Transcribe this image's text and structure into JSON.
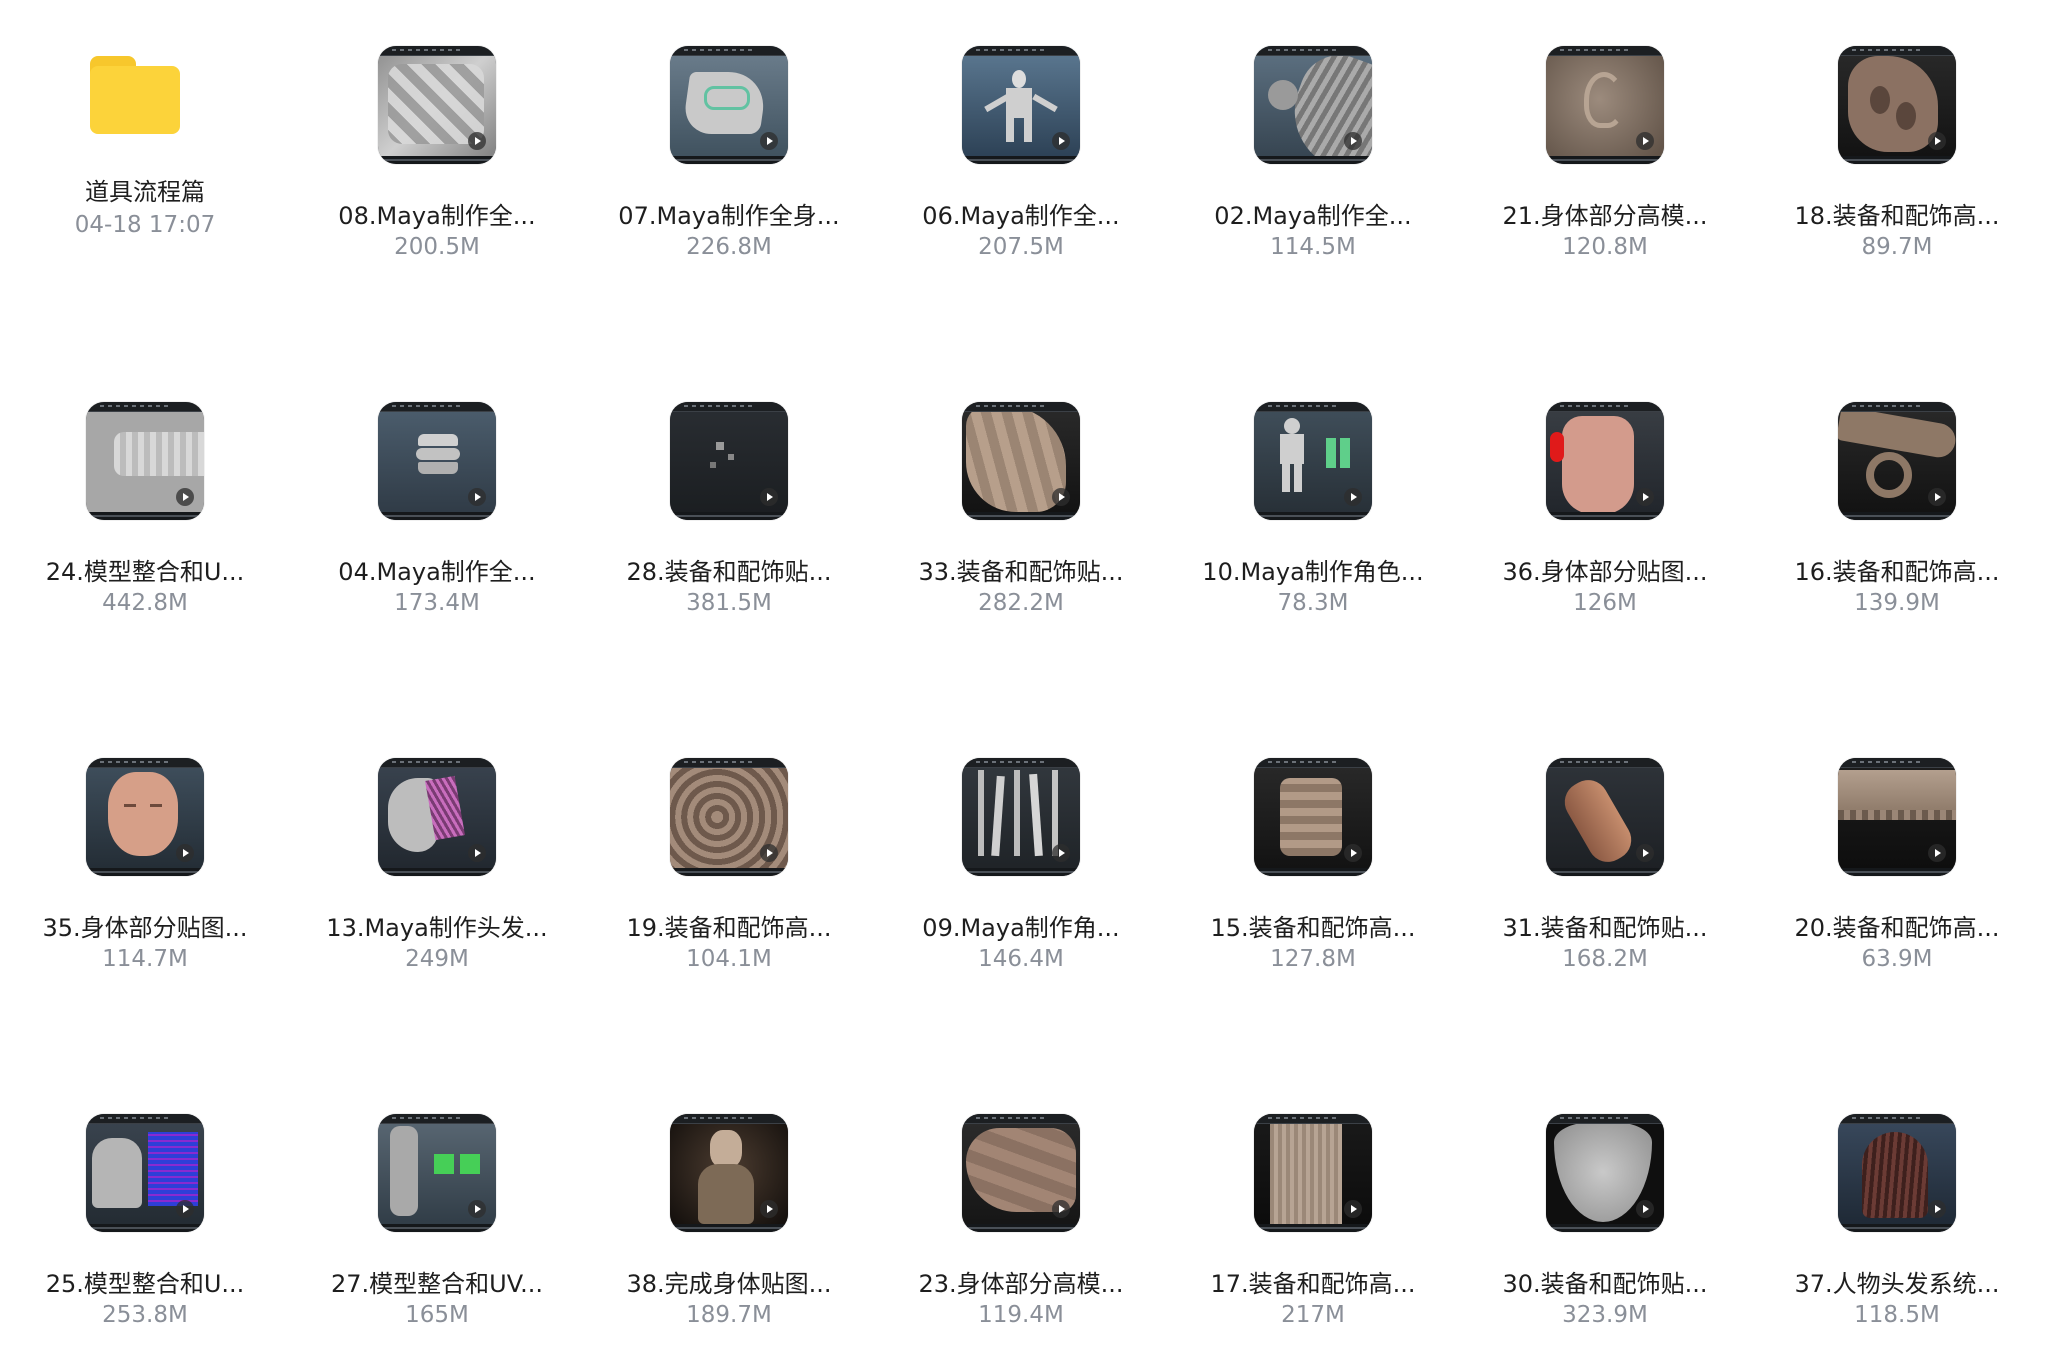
{
  "folder": {
    "name": "道具流程篇",
    "date": "04-18 17:07"
  },
  "files": [
    {
      "name": "08.Maya制作全...",
      "size": "200.5M",
      "thumb": "stone-relief"
    },
    {
      "name": "07.Maya制作全身...",
      "size": "226.8M",
      "thumb": "armor-green"
    },
    {
      "name": "06.Maya制作全...",
      "size": "207.5M",
      "thumb": "figure-blue"
    },
    {
      "name": "02.Maya制作全...",
      "size": "114.5M",
      "thumb": "shoulder-gray"
    },
    {
      "name": "21.身体部分高模...",
      "size": "120.8M",
      "thumb": "ear-sculpt"
    },
    {
      "name": "18.装备和配饰高...",
      "size": "89.7M",
      "thumb": "ornament-brown"
    },
    {
      "name": "24.模型整合和U...",
      "size": "442.8M",
      "thumb": "cylinder-gray"
    },
    {
      "name": "04.Maya制作全...",
      "size": "173.4M",
      "thumb": "plates-gray"
    },
    {
      "name": "28.装备和配饰贴...",
      "size": "381.5M",
      "thumb": "dark-viewport"
    },
    {
      "name": "33.装备和配饰贴...",
      "size": "282.2M",
      "thumb": "armor-tan"
    },
    {
      "name": "10.Maya制作角色...",
      "size": "78.3M",
      "thumb": "figure-green"
    },
    {
      "name": "36.身体部分贴图...",
      "size": "126M",
      "thumb": "hand-red"
    },
    {
      "name": "16.装备和配饰高...",
      "size": "139.9M",
      "thumb": "scroll-brown"
    },
    {
      "name": "35.身体部分贴图...",
      "size": "114.7M",
      "thumb": "face"
    },
    {
      "name": "13.Maya制作头发...",
      "size": "249M",
      "thumb": "hair-pink"
    },
    {
      "name": "19.装备和配饰高...",
      "size": "104.1M",
      "thumb": "pattern-brown"
    },
    {
      "name": "09.Maya制作角...",
      "size": "146.4M",
      "thumb": "strands-gray"
    },
    {
      "name": "15.装备和配饰高...",
      "size": "127.8M",
      "thumb": "drum-brown"
    },
    {
      "name": "31.装备和配饰贴...",
      "size": "168.2M",
      "thumb": "finger-copper"
    },
    {
      "name": "20.装备和配饰高...",
      "size": "63.9M",
      "thumb": "band-tan"
    },
    {
      "name": "25.模型整合和U...",
      "size": "253.8M",
      "thumb": "uv-blue"
    },
    {
      "name": "27.模型整合和UV...",
      "size": "165M",
      "thumb": "uv-green"
    },
    {
      "name": "38.完成身体贴图...",
      "size": "189.7M",
      "thumb": "character-dark"
    },
    {
      "name": "23.身体部分高模...",
      "size": "119.4M",
      "thumb": "foot-sculpt"
    },
    {
      "name": "17.装备和配饰高...",
      "size": "217M",
      "thumb": "column-tan"
    },
    {
      "name": "30.装备和配饰贴...",
      "size": "323.9M",
      "thumb": "shield-gray"
    },
    {
      "name": "37.人物头发系统...",
      "size": "118.5M",
      "thumb": "hair-red"
    }
  ]
}
